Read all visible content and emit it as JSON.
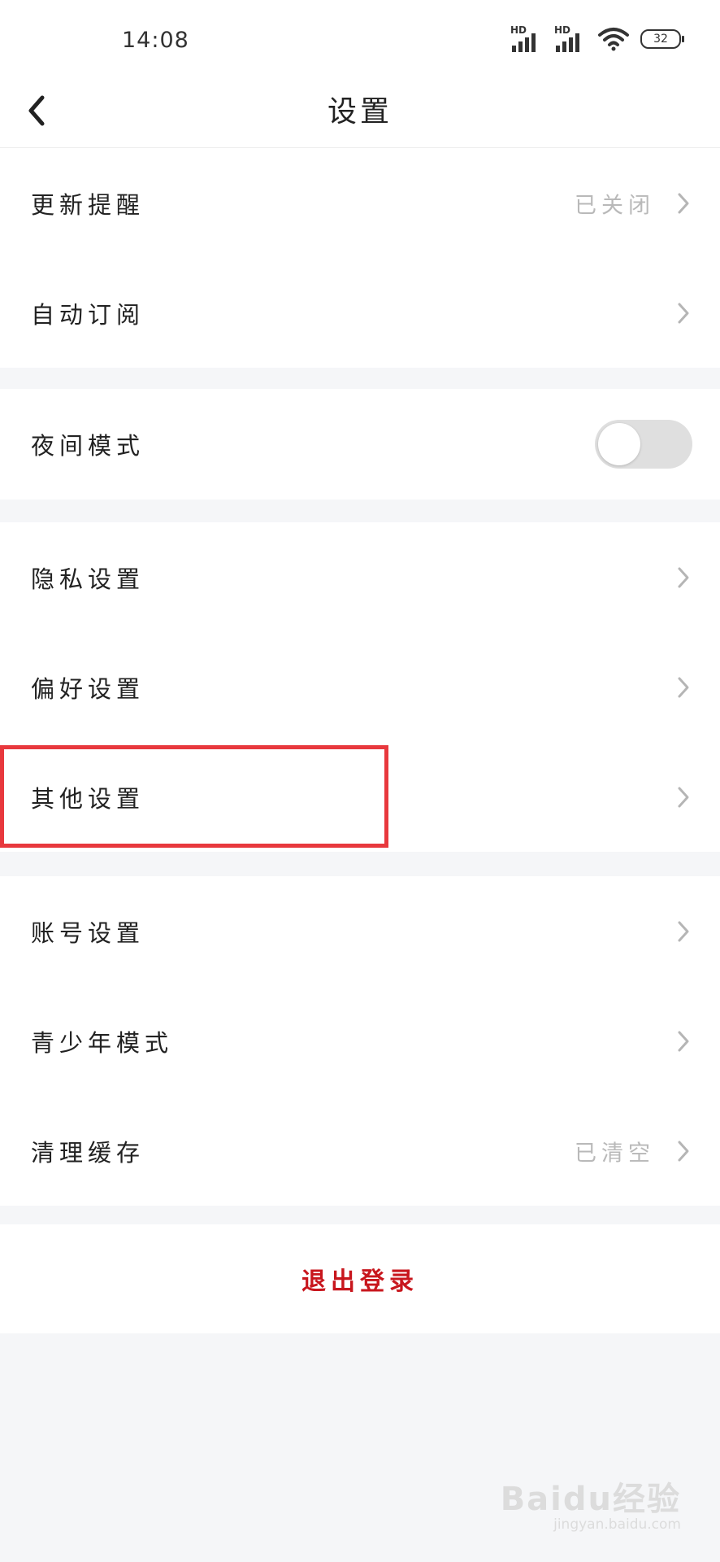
{
  "status_bar": {
    "time": "14:08",
    "signal_1_label": "HD",
    "signal_2_label": "HD",
    "battery": "32"
  },
  "header": {
    "title": "设置"
  },
  "groups": [
    {
      "items": [
        {
          "label": "更新提醒",
          "value": "已关闭"
        },
        {
          "label": "自动订阅",
          "value": ""
        }
      ]
    },
    {
      "items": [
        {
          "label": "夜间模式",
          "toggle_on": false
        }
      ]
    },
    {
      "items": [
        {
          "label": "隐私设置"
        },
        {
          "label": "偏好设置"
        },
        {
          "label": "其他设置",
          "highlighted": true
        }
      ]
    },
    {
      "items": [
        {
          "label": "账号设置"
        },
        {
          "label": "青少年模式"
        },
        {
          "label": "清理缓存",
          "value": "已清空"
        }
      ]
    }
  ],
  "logout": {
    "label": "退出登录"
  },
  "watermark": {
    "main": "Baidu经验",
    "sub": "jingyan.baidu.com"
  },
  "colors": {
    "accent_logout": "#c8161d",
    "highlight_box": "#e8383d",
    "background": "#f5f6f8",
    "toggle_off": "#dfdfdf"
  }
}
